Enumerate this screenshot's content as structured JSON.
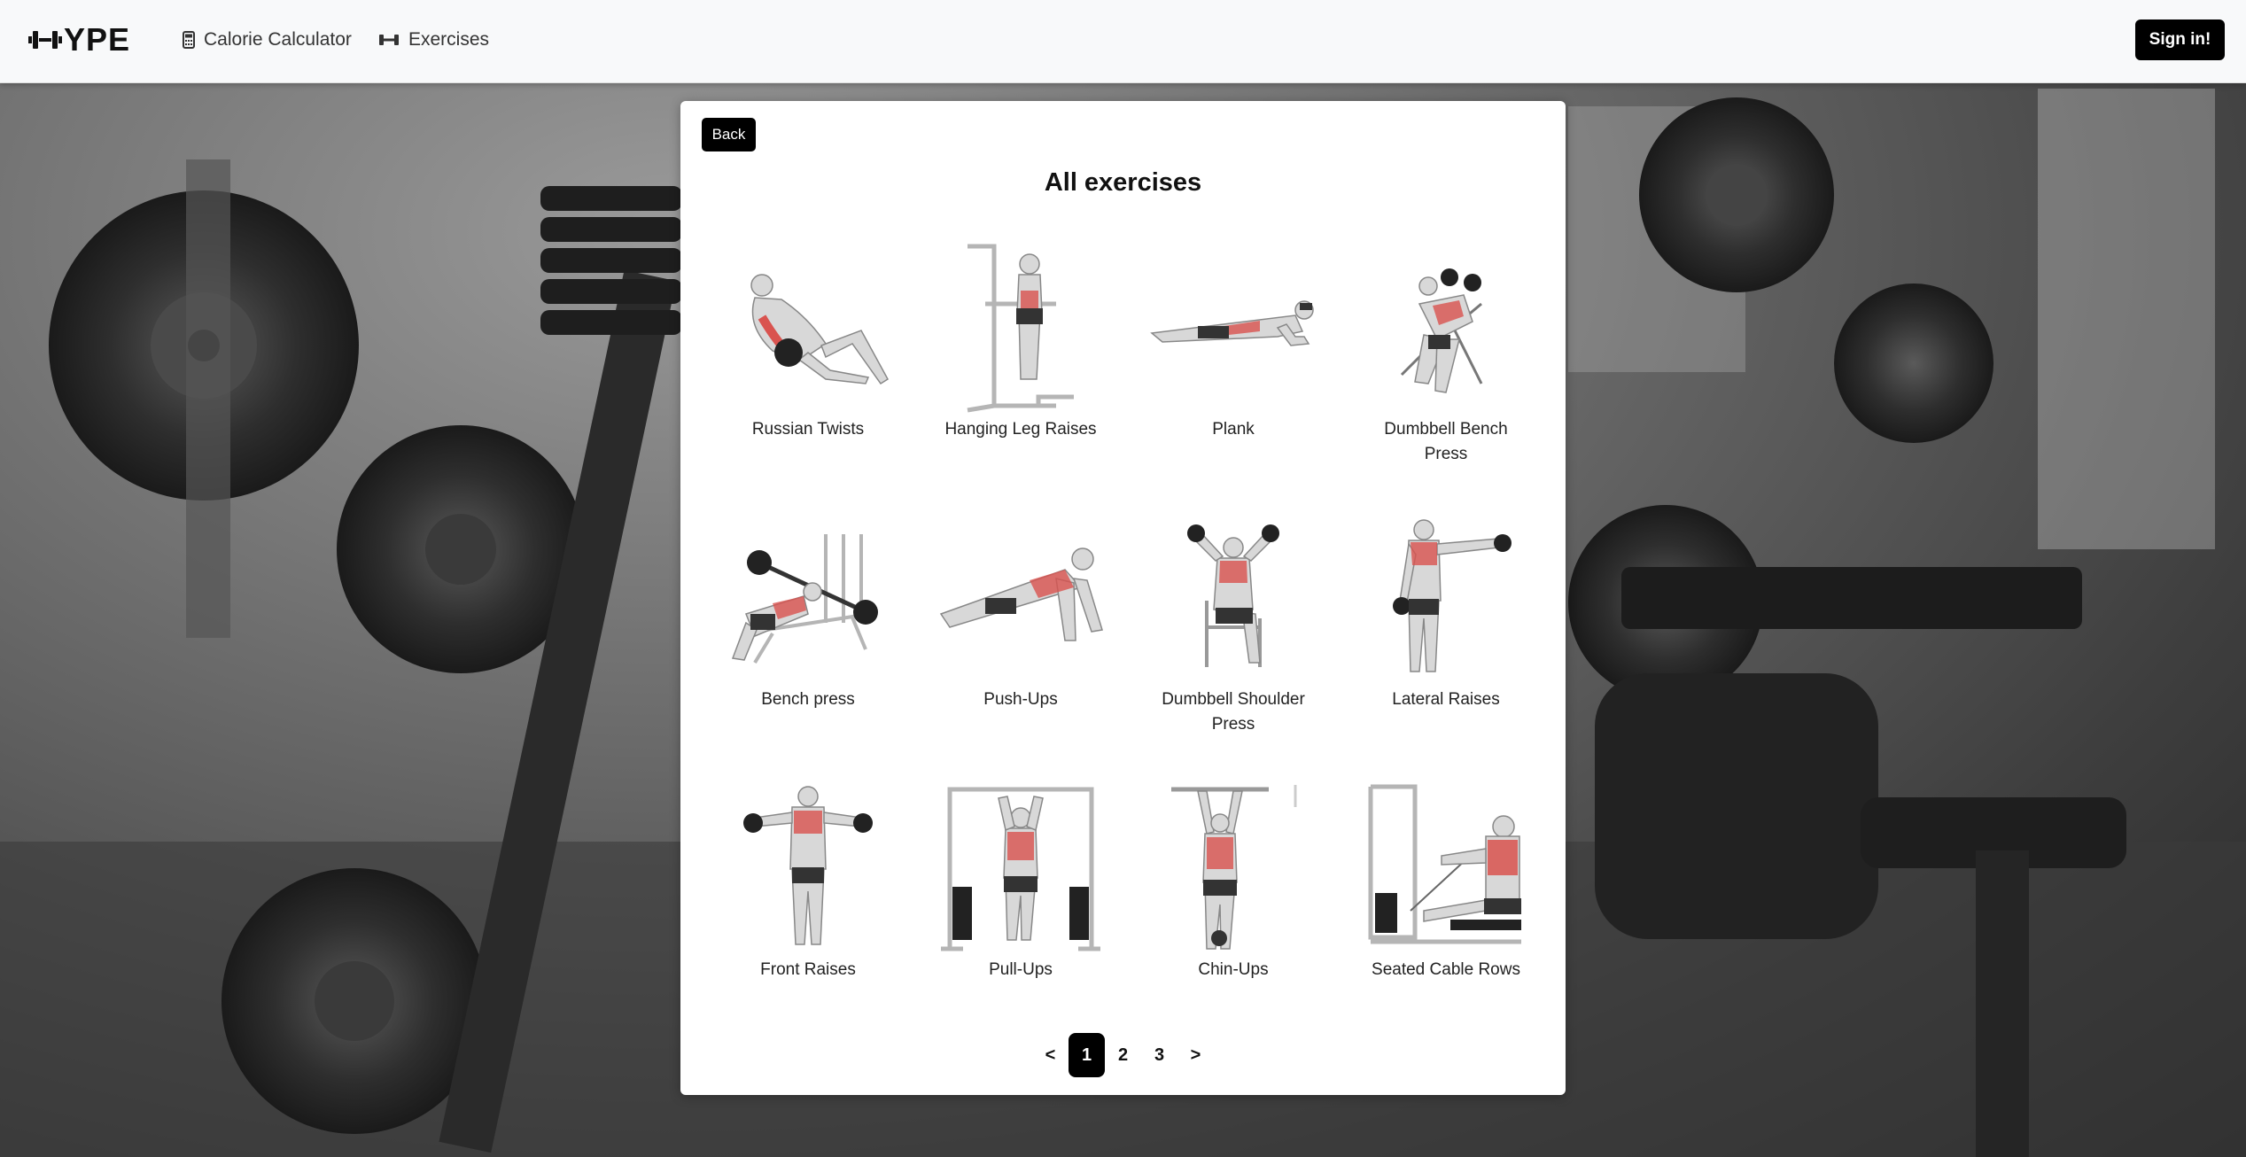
{
  "navbar": {
    "brand": "YPE",
    "links": [
      {
        "label": "Calorie Calculator",
        "icon": "calculator-icon"
      },
      {
        "label": "Exercises",
        "icon": "dumbbell-icon"
      }
    ],
    "signin_label": "Sign in!"
  },
  "card": {
    "back_label": "Back",
    "title": "All exercises"
  },
  "exercises": [
    {
      "name": "Russian Twists"
    },
    {
      "name": "Hanging Leg Raises"
    },
    {
      "name": "Plank"
    },
    {
      "name": "Dumbbell Bench Press"
    },
    {
      "name": "Bench press"
    },
    {
      "name": "Push-Ups"
    },
    {
      "name": "Dumbbell Shoulder Press"
    },
    {
      "name": "Lateral Raises"
    },
    {
      "name": "Front Raises"
    },
    {
      "name": "Pull-Ups"
    },
    {
      "name": "Chin-Ups"
    },
    {
      "name": "Seated Cable Rows"
    }
  ],
  "pagination": {
    "prev": "<",
    "pages": [
      "1",
      "2",
      "3"
    ],
    "current": "1",
    "next": ">"
  },
  "colors": {
    "navbar_bg": "#f8f9fa",
    "button_bg": "#000000",
    "muscle_highlight": "#d9534f"
  }
}
